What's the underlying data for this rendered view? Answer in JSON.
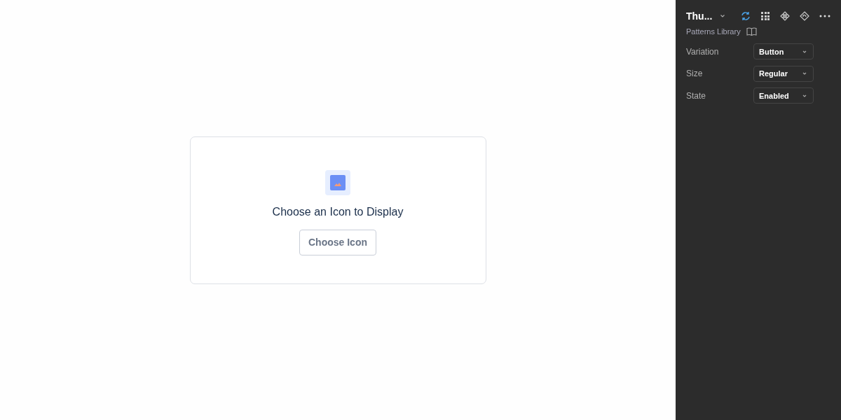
{
  "card": {
    "heading": "Choose an Icon to Display",
    "button": "Choose Icon"
  },
  "panel": {
    "title": "Thu...",
    "library": "Patterns Library",
    "properties": [
      {
        "label": "Variation",
        "value": "Button"
      },
      {
        "label": "Size",
        "value": "Regular"
      },
      {
        "label": "State",
        "value": "Enabled"
      }
    ]
  }
}
